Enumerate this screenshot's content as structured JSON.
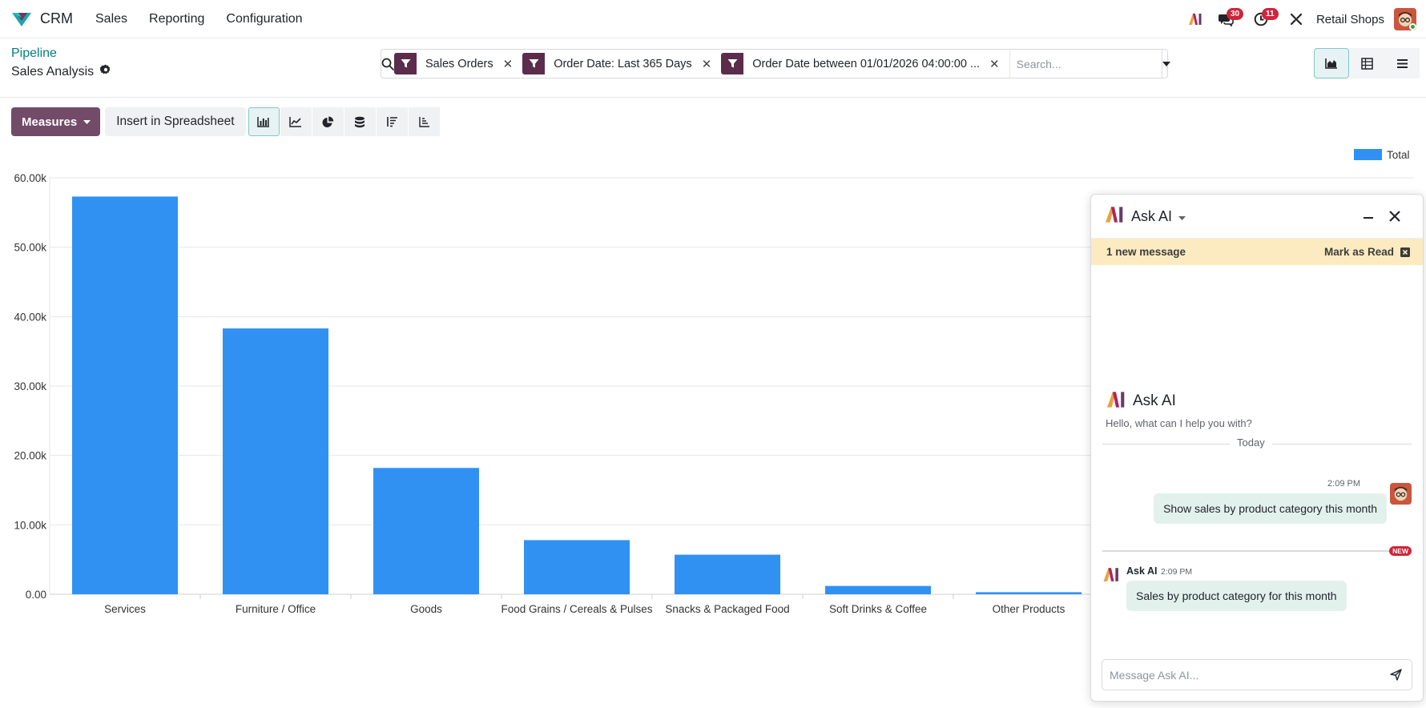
{
  "app": {
    "name": "CRM"
  },
  "menu": [
    "Sales",
    "Reporting",
    "Configuration"
  ],
  "nav": {
    "messages_count": "30",
    "activities_count": "11",
    "company": "Retail Shops"
  },
  "breadcrumb": {
    "parent": "Pipeline",
    "current": "Sales Analysis"
  },
  "search": {
    "facets": [
      {
        "label": "Sales Orders"
      },
      {
        "label": "Order Date: Last 365 Days"
      },
      {
        "label": "Order Date between 01/01/2026 04:00:00 ..."
      }
    ],
    "placeholder": "Search..."
  },
  "toolbar": {
    "measures_label": "Measures",
    "spreadsheet_label": "Insert in Spreadsheet"
  },
  "chart_data": {
    "type": "bar",
    "categories": [
      "Services",
      "Furniture / Office",
      "Goods",
      "Food Grains / Cereals & Pulses",
      "Snacks & Packaged Food",
      "Soft Drinks & Coffee",
      "Other Products"
    ],
    "series": [
      {
        "name": "Total",
        "values": [
          57300,
          38300,
          18200,
          7800,
          5700,
          1200,
          300
        ],
        "color": "#3091f2"
      }
    ],
    "ylim": [
      0,
      60000
    ],
    "yticks": [
      "0.00",
      "10.00k",
      "20.00k",
      "30.00k",
      "40.00k",
      "50.00k",
      "60.00k"
    ],
    "legend": "top-right",
    "grid": true
  },
  "ai_panel": {
    "title": "Ask AI",
    "notice": "1 new message",
    "mark_read": "Mark as Read",
    "welcome_title": "Ask AI",
    "welcome_text": "Hello, what can I help you with?",
    "day_label": "Today",
    "user_message": {
      "time": "2:09 PM",
      "text": "Show sales by product category this month"
    },
    "new_badge": "NEW",
    "ai_message": {
      "author": "Ask AI",
      "time": "2:09 PM",
      "text": "Sales by product category for this month"
    },
    "composer_placeholder": "Message Ask AI..."
  }
}
